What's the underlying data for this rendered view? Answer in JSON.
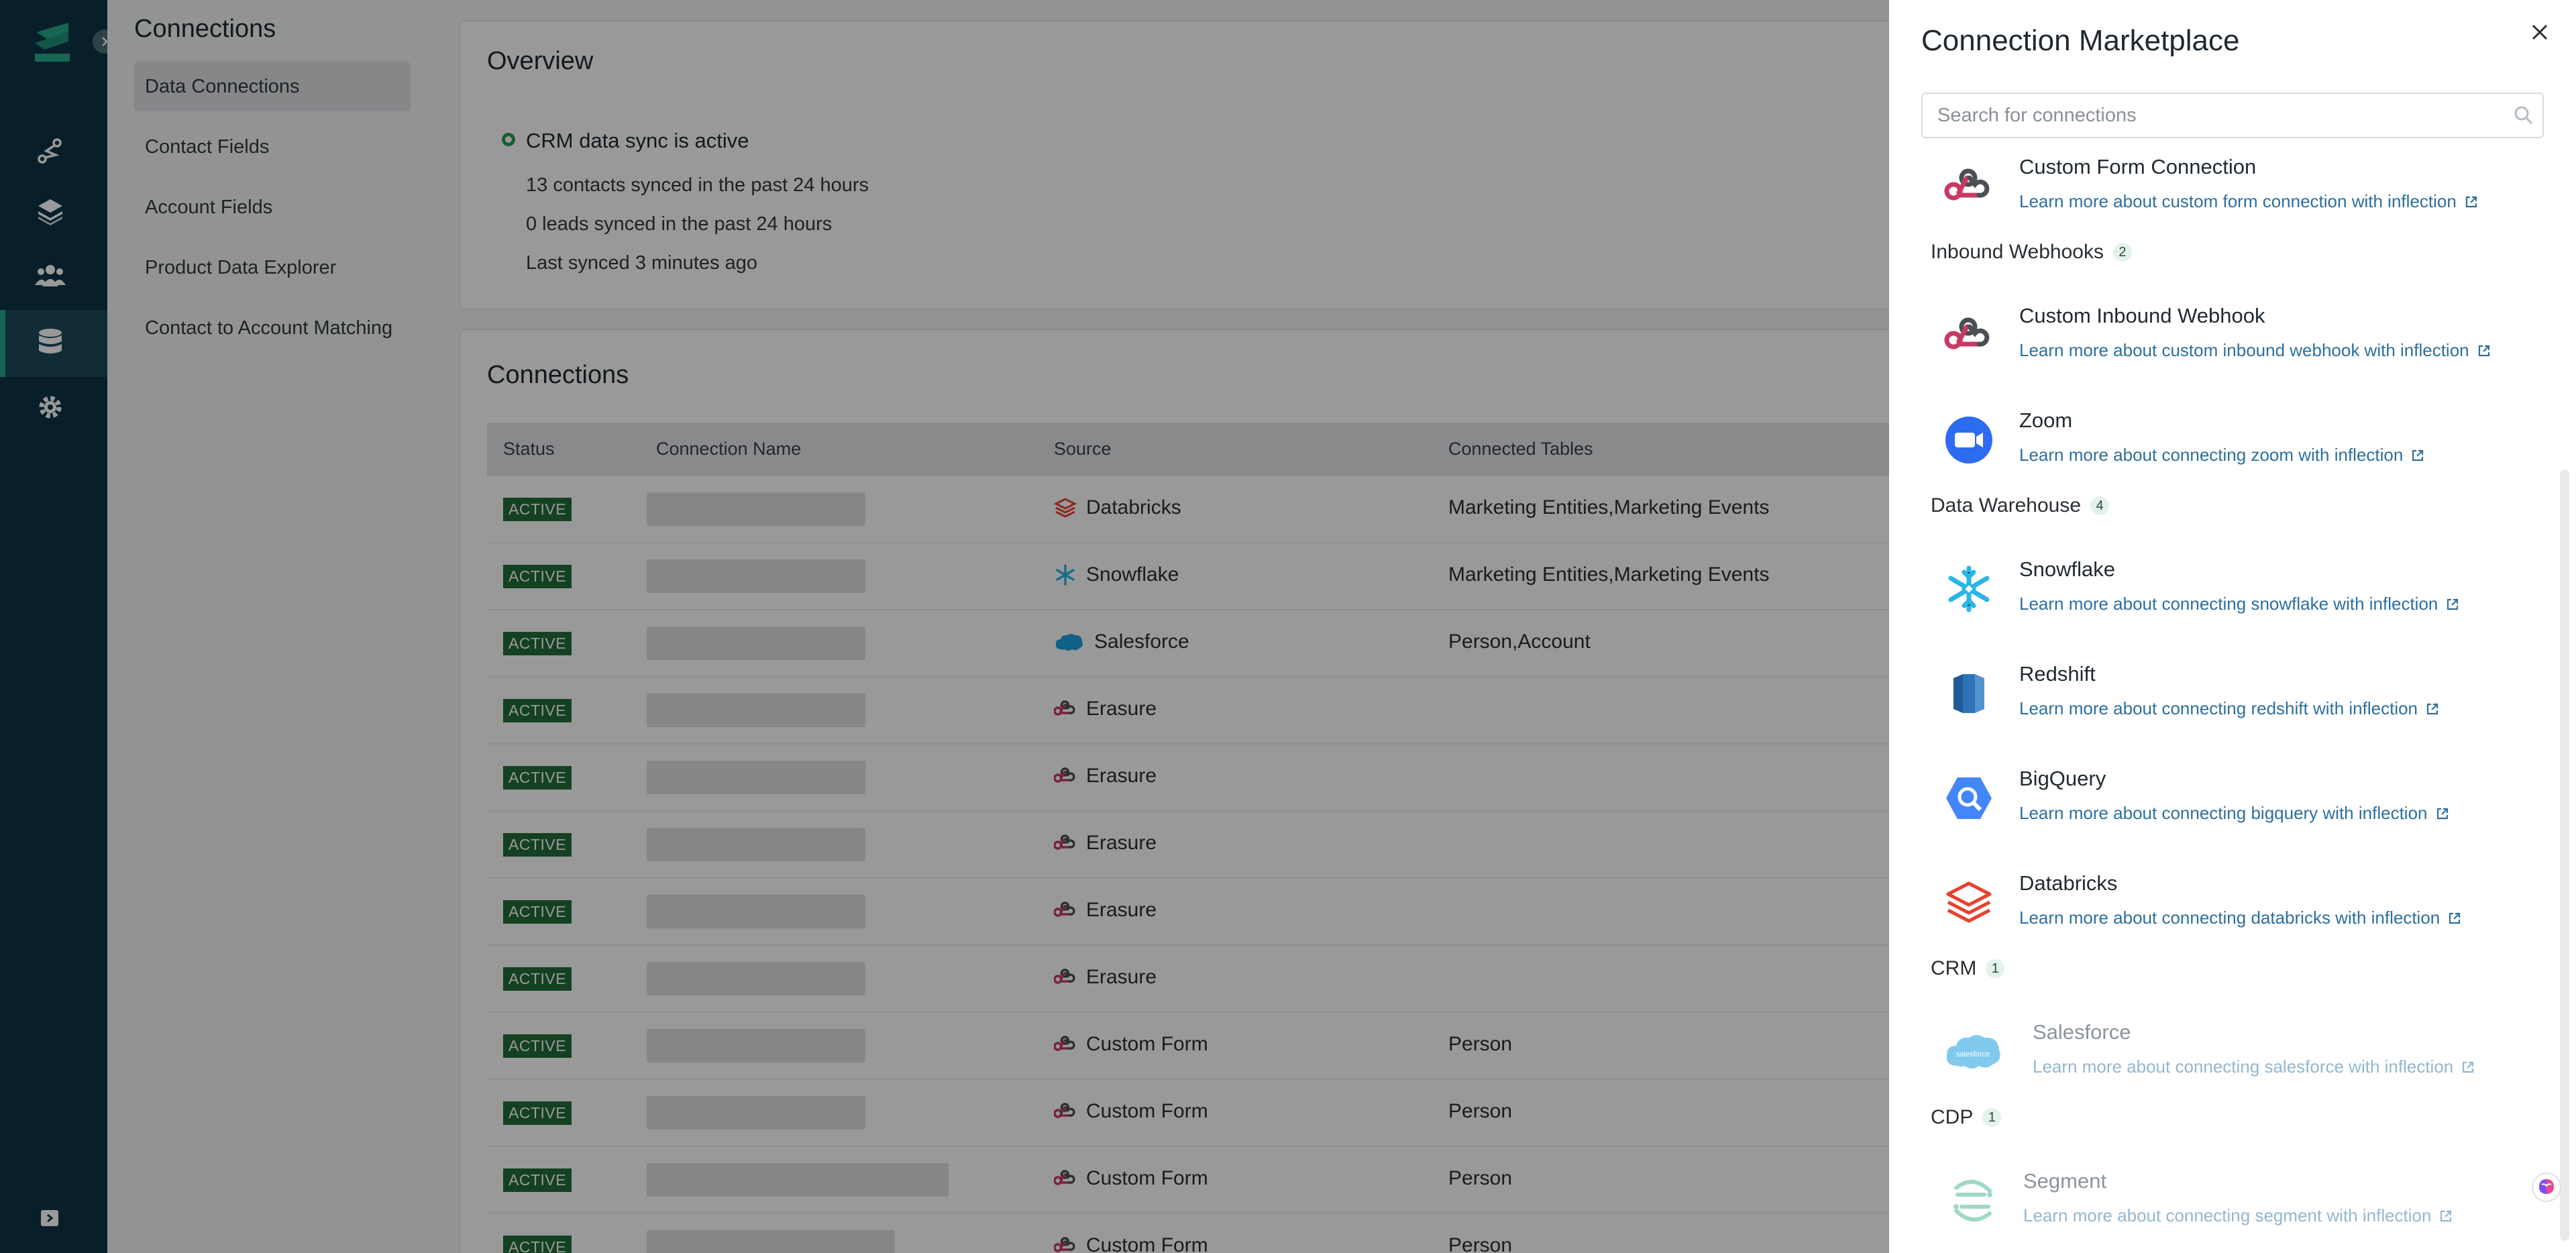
{
  "subnav": {
    "title": "Connections",
    "items": [
      {
        "label": "Data Connections",
        "active": true
      },
      {
        "label": "Contact Fields",
        "active": false
      },
      {
        "label": "Account Fields",
        "active": false
      },
      {
        "label": "Product Data Explorer",
        "active": false
      },
      {
        "label": "Contact to Account Matching",
        "active": false
      }
    ]
  },
  "rail": {
    "icons": [
      "logo-icon",
      "journey-icon",
      "layers-icon",
      "people-icon",
      "database-icon",
      "gear-icon",
      "collapse-icon"
    ]
  },
  "overview": {
    "title": "Overview",
    "status": "CRM data sync is active",
    "lines": [
      "13 contacts synced in the past 24 hours",
      "0 leads synced in the past 24 hours",
      "Last synced 3 minutes ago"
    ]
  },
  "connections": {
    "title": "Connections",
    "headers": {
      "status": "Status",
      "name": "Connection Name",
      "source": "Source",
      "tables": "Connected Tables"
    },
    "rows": [
      {
        "status": "ACTIVE",
        "source": "Databricks",
        "icon": "databricks-icon",
        "tables": "Marketing Entities,Marketing Events"
      },
      {
        "status": "ACTIVE",
        "source": "Snowflake",
        "icon": "snowflake-icon",
        "tables": "Marketing Entities,Marketing Events"
      },
      {
        "status": "ACTIVE",
        "source": "Salesforce",
        "icon": "salesforce-icon",
        "tables": "Person,Account"
      },
      {
        "status": "ACTIVE",
        "source": "Erasure",
        "icon": "webhook-icon",
        "tables": ""
      },
      {
        "status": "ACTIVE",
        "source": "Erasure",
        "icon": "webhook-icon",
        "tables": ""
      },
      {
        "status": "ACTIVE",
        "source": "Erasure",
        "icon": "webhook-icon",
        "tables": ""
      },
      {
        "status": "ACTIVE",
        "source": "Erasure",
        "icon": "webhook-icon",
        "tables": ""
      },
      {
        "status": "ACTIVE",
        "source": "Erasure",
        "icon": "webhook-icon",
        "tables": ""
      },
      {
        "status": "ACTIVE",
        "source": "Custom Form",
        "icon": "webhook-icon",
        "tables": "Person"
      },
      {
        "status": "ACTIVE",
        "source": "Custom Form",
        "icon": "webhook-icon",
        "tables": "Person"
      },
      {
        "status": "ACTIVE",
        "source": "Custom Form",
        "icon": "webhook-icon",
        "tables": "Person"
      },
      {
        "status": "ACTIVE",
        "source": "Custom Form",
        "icon": "webhook-icon",
        "tables": "Person"
      }
    ]
  },
  "marketplace": {
    "title": "Connection Marketplace",
    "search_placeholder": "Search for connections",
    "categories": {
      "inbound": {
        "label": "Inbound Webhooks",
        "count": "2"
      },
      "warehouse": {
        "label": "Data Warehouse",
        "count": "4"
      },
      "crm": {
        "label": "CRM",
        "count": "1"
      },
      "cdp": {
        "label": "CDP",
        "count": "1"
      }
    },
    "entries": {
      "custom_form": {
        "name": "Custom Form Connection",
        "link": "Learn more about custom form connection with inflection"
      },
      "custom_inbound": {
        "name": "Custom Inbound Webhook",
        "link": "Learn more about custom inbound webhook with inflection"
      },
      "zoom": {
        "name": "Zoom",
        "link": "Learn more about connecting zoom with inflection"
      },
      "snowflake": {
        "name": "Snowflake",
        "link": "Learn more about connecting snowflake with inflection"
      },
      "redshift": {
        "name": "Redshift",
        "link": "Learn more about connecting redshift with inflection"
      },
      "bigquery": {
        "name": "BigQuery",
        "link": "Learn more about connecting bigquery with inflection"
      },
      "databricks": {
        "name": "Databricks",
        "link": "Learn more about connecting databricks with inflection"
      },
      "salesforce": {
        "name": "Salesforce",
        "link": "Learn more about connecting salesforce with inflection",
        "logo_text": "salesforce"
      },
      "segment": {
        "name": "Segment",
        "link": "Learn more about connecting segment with inflection"
      }
    }
  },
  "colors": {
    "rail": "#0e3447",
    "accent": "#27a88a",
    "active_badge": "#226d39",
    "link": "#2d6f9e"
  }
}
